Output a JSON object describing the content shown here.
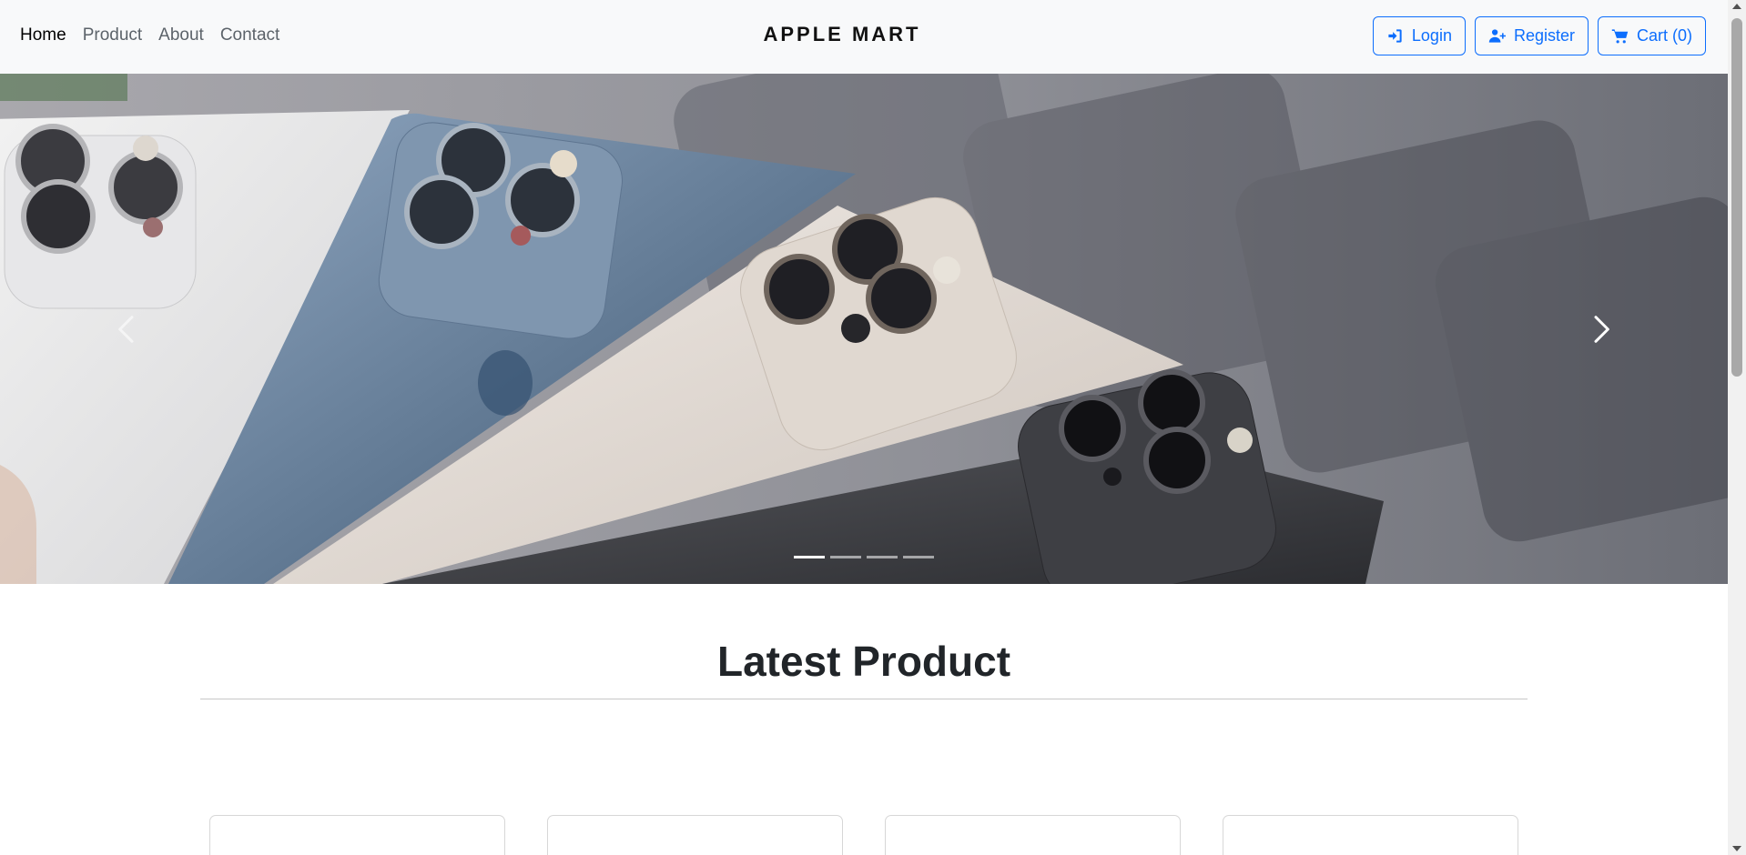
{
  "navbar": {
    "links": [
      {
        "label": "Home",
        "active": true
      },
      {
        "label": "Product",
        "active": false
      },
      {
        "label": "About",
        "active": false
      },
      {
        "label": "Contact",
        "active": false
      }
    ],
    "brand": "APPLE MART",
    "actions": {
      "login_label": "Login",
      "login_icon": "sign-in-icon",
      "register_label": "Register",
      "register_icon": "user-plus-icon",
      "cart_label": "Cart (0)",
      "cart_icon": "shopping-cart-icon"
    },
    "accent_color": "#0d6efd"
  },
  "carousel": {
    "slide_count": 4,
    "active_index": 0,
    "prev_icon": "chevron-left-icon",
    "next_icon": "chevron-right-icon",
    "image_subject": "iPhone 12 Pro phones fanned out"
  },
  "section": {
    "title": "Latest Product"
  },
  "products": [
    {
      "placeholder": "product card 1"
    },
    {
      "placeholder": "product card 2"
    },
    {
      "placeholder": "product card 3"
    },
    {
      "placeholder": "product card 4"
    }
  ]
}
